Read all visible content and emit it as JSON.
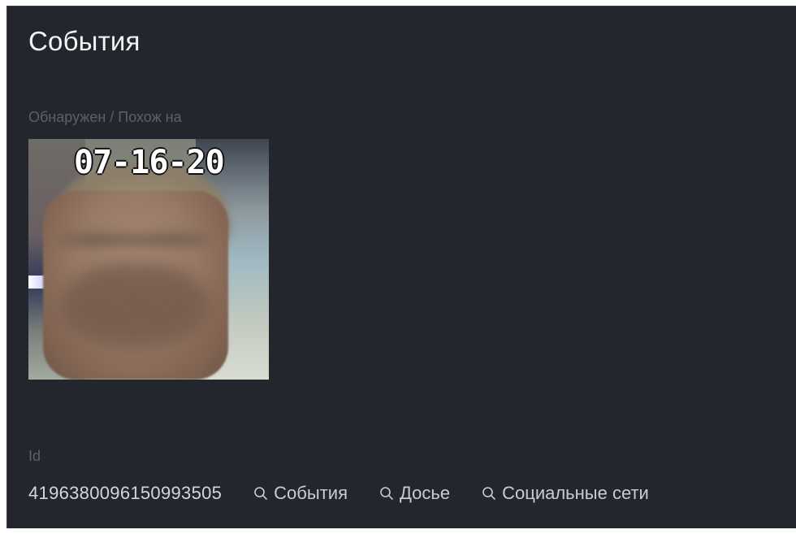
{
  "header": {
    "title": "События"
  },
  "detection": {
    "section_label": "Обнаружен / Похож на",
    "thumbnail_timestamp": "07-16-20"
  },
  "details": {
    "id_label": "Id",
    "id_value": "4196380096150993505"
  },
  "actions": [
    {
      "label": "События",
      "icon": "search-icon"
    },
    {
      "label": "Досье",
      "icon": "search-icon"
    },
    {
      "label": "Социальные сети",
      "icon": "search-icon"
    }
  ]
}
